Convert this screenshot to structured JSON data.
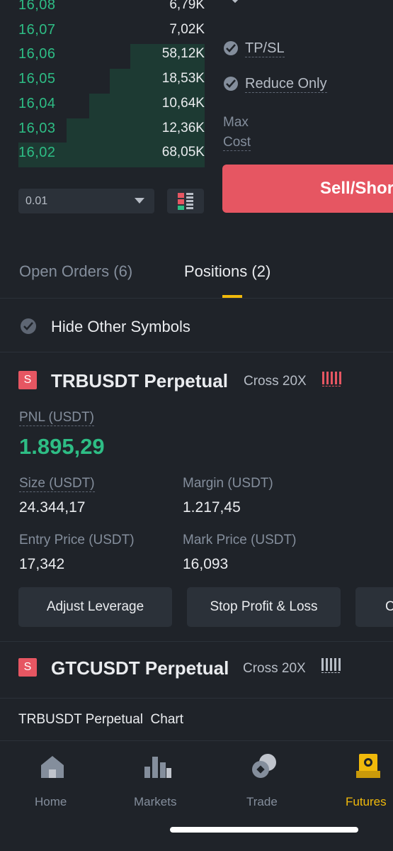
{
  "order_book": {
    "rows": [
      {
        "price": "16,08",
        "qty": "6,79K",
        "depth": 0.0
      },
      {
        "price": "16,07",
        "qty": "7,02K",
        "depth": 0.0
      },
      {
        "price": "16,06",
        "qty": "58,12K",
        "depth": 0.4
      },
      {
        "price": "16,05",
        "qty": "18,53K",
        "depth": 0.51
      },
      {
        "price": "16,04",
        "qty": "10,64K",
        "depth": 0.62
      },
      {
        "price": "16,03",
        "qty": "12,36K",
        "depth": 0.74
      },
      {
        "price": "16,02",
        "qty": "68,05K",
        "depth": 1.0
      }
    ],
    "precision": "0.01"
  },
  "order_form": {
    "tpsl_label": "TP/SL",
    "reduce_only_label": "Reduce Only",
    "max_label": "Max",
    "cost_label": "Cost",
    "sell_button": "Sell/Short"
  },
  "tabs": [
    {
      "label": "Open Orders (6)",
      "active": false
    },
    {
      "label": "Positions (2)",
      "active": true
    }
  ],
  "filter": {
    "hide_other_symbols": "Hide Other Symbols"
  },
  "positions": [
    {
      "side_badge": "S",
      "symbol": "TRBUSDT Perpetual",
      "margin_mode": "Cross 20X",
      "pnl_label": "PNL (USDT)",
      "pnl_value": "1.895,29",
      "size_label": "Size (USDT)",
      "size_value": "24.344,17",
      "margin_label": "Margin (USDT)",
      "margin_value": "1.217,45",
      "entry_label": "Entry Price (USDT)",
      "entry_value": "17,342",
      "mark_label": "Mark Price (USDT)",
      "mark_value": "16,093",
      "risk_level": 4
    },
    {
      "side_badge": "S",
      "symbol": "GTCUSDT Perpetual",
      "margin_mode": "Cross 20X",
      "risk_level": 0
    }
  ],
  "position_actions": {
    "adjust_leverage": "Adjust Leverage",
    "stop_profit_loss": "Stop Profit & Loss",
    "close": "Close"
  },
  "chart_link": "TRBUSDT Perpetual  Chart",
  "bottom_nav": [
    {
      "label": "Home",
      "icon": "home-icon"
    },
    {
      "label": "Markets",
      "icon": "markets-icon"
    },
    {
      "label": "Trade",
      "icon": "trade-icon"
    },
    {
      "label": "Futures",
      "icon": "futures-icon",
      "active": true
    }
  ],
  "colors": {
    "background": "#1f2329",
    "buy_green": "#2ebd85",
    "sell_red": "#e65662",
    "accent_yellow": "#f0b90b",
    "muted_text": "#848e9c"
  }
}
